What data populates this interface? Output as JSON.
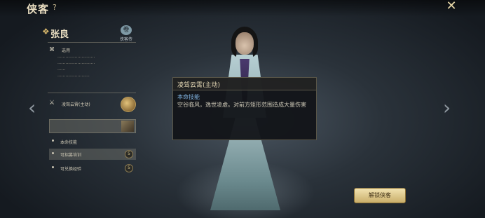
{
  "header": {
    "title": "侠客",
    "help": "?",
    "close": "✕"
  },
  "nav": {
    "left_arrow": "‹",
    "right_arrow": "›"
  },
  "hero": {
    "name": "张良",
    "emblem": "❖",
    "scroll_label": "侠客传",
    "scroll_icon": "卷",
    "section_icon": "⌘",
    "section_label": "选用",
    "desc_lines": [
      "····························",
      "····························",
      "······",
      "························"
    ]
  },
  "skill": {
    "icon": "⚔",
    "label": "凌驾云霄(主动)"
  },
  "options": [
    {
      "label": "本命技能",
      "badge": ""
    },
    {
      "label": "可招募培训",
      "badge": "5"
    },
    {
      "label": "可兑换经验",
      "badge": "5"
    }
  ],
  "tooltip": {
    "title": "凌驾云霄(主动)",
    "subtitle": "本命技能",
    "body": "空谷临风，逸世凌虚。对前方矩形范围造成大量伤害"
  },
  "recruit_button": "解锁侠客"
}
